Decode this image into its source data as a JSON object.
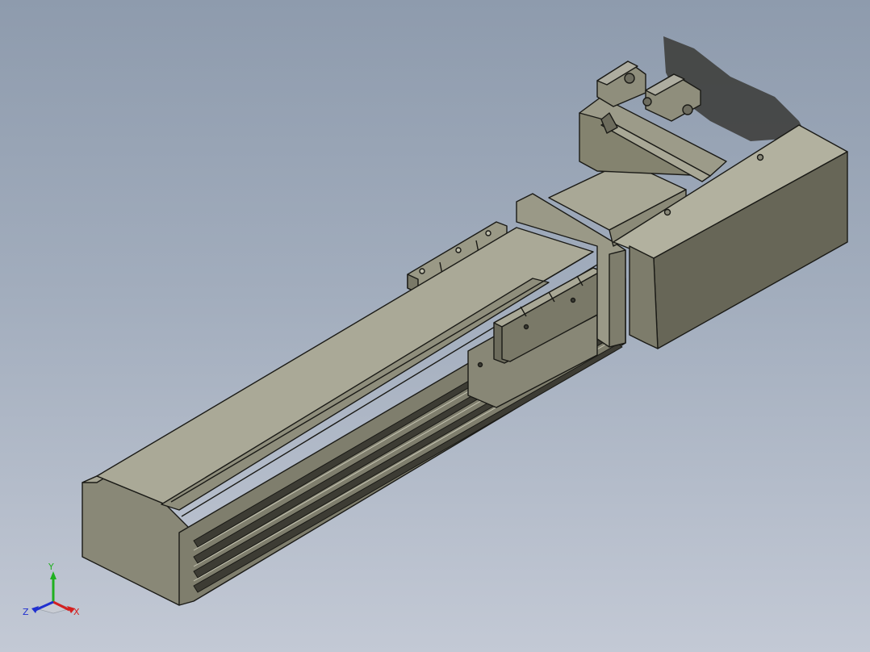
{
  "view": {
    "background_top": "#8e9bad",
    "background_bottom": "#c3c9d5",
    "model_face_light": "#a8a795",
    "model_face_mid": "#8c8b78",
    "model_face_dark": "#6f6e5f",
    "edge_color": "#1a1a16"
  },
  "triad": {
    "x_label": "X",
    "y_label": "Y",
    "z_label": "Z",
    "x_color": "#d42020",
    "y_color": "#20b020",
    "z_color": "#2030d0"
  }
}
